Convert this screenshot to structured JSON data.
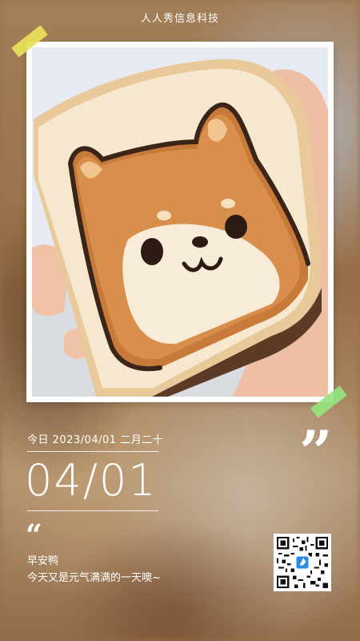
{
  "brand": "人人秀信息科技",
  "date_line": "今日 2023/04/01 二月二十",
  "big_date": "04/01",
  "quote_close": "”",
  "quote_open": "“",
  "greeting": "早安鸭",
  "message": "今天又是元气满满的一天噢~",
  "photo": {
    "subject": "shiba-toast-photo"
  },
  "qr": {
    "icon": "qr-code-icon"
  },
  "colors": {
    "tape_yellow": "#e8e25a",
    "tape_green": "#96e47d",
    "text": "#ffffff"
  }
}
